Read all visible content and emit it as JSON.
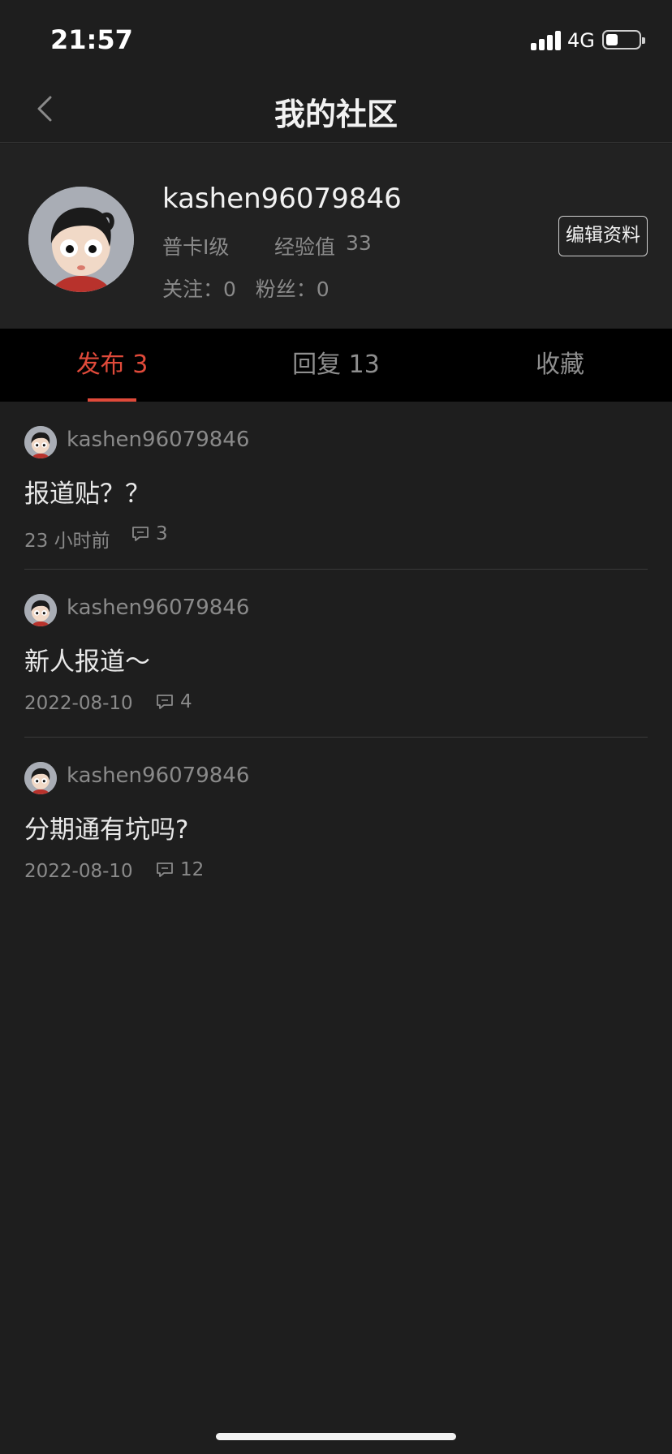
{
  "status_bar": {
    "time": "21:57",
    "network": "4G"
  },
  "nav": {
    "title": "我的社区",
    "back_icon": "chevron-left-icon"
  },
  "profile": {
    "username": "kashen96079846",
    "level": "普卡I级",
    "exp_label": "经验值",
    "exp_value": "33",
    "follow_text": "关注：0   粉丝：0",
    "edit_label": "编辑资料"
  },
  "tabs": [
    {
      "label": "发布 3",
      "active": true
    },
    {
      "label": "回复 13",
      "active": false
    },
    {
      "label": "收藏",
      "active": false
    }
  ],
  "posts": [
    {
      "author": "kashen96079846",
      "title": "报道贴？？",
      "date": "23 小时前",
      "comments": "3"
    },
    {
      "author": "kashen96079846",
      "title": "新人报道～",
      "date": "2022-08-10",
      "comments": "4"
    },
    {
      "author": "kashen96079846",
      "title": "分期通有坑吗?",
      "date": "2022-08-10",
      "comments": "12"
    }
  ],
  "colors": {
    "accent": "#e04a3a",
    "background": "#1e1e1e",
    "tab_bar": "#000000"
  }
}
